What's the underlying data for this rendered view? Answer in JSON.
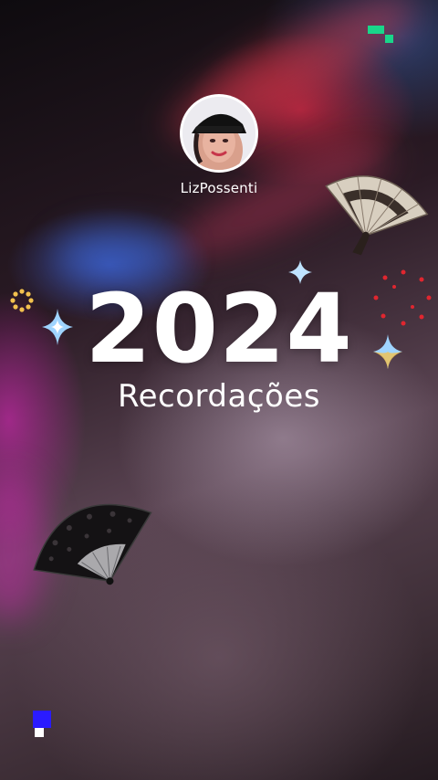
{
  "profile": {
    "username": "LizPossenti"
  },
  "recap": {
    "year": "2024",
    "title": "Recordações"
  },
  "decorations": {
    "sparkle_color": "#9fd4ff",
    "sparkle_warm_color": "#f2c14e",
    "pixel_green": "#19d68a",
    "pixel_blue": "#2a1bff",
    "dots_red": "#e0262f",
    "sun_yellow": "#f2c14e"
  }
}
